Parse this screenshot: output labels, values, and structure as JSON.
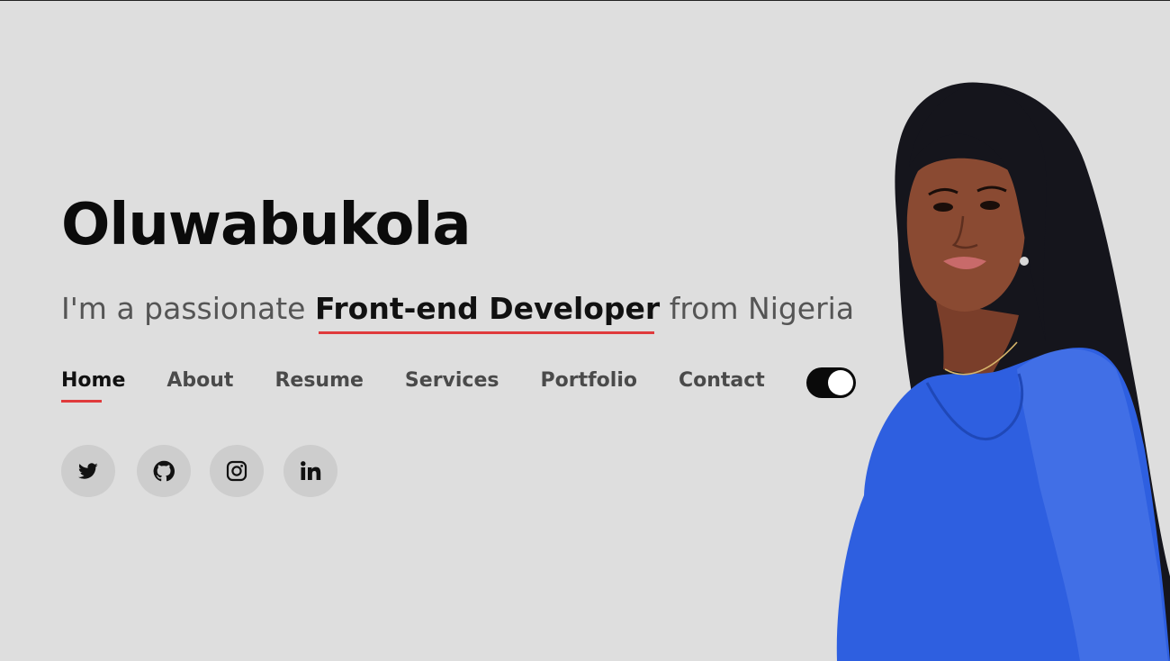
{
  "hero": {
    "name": "Oluwabukola",
    "tagline_prefix": "I'm a passionate",
    "tagline_role": "Front-end Developer",
    "tagline_suffix": "from Nigeria"
  },
  "nav": {
    "items": [
      {
        "label": "Home",
        "active": true
      },
      {
        "label": "About",
        "active": false
      },
      {
        "label": "Resume",
        "active": false
      },
      {
        "label": "Services",
        "active": false
      },
      {
        "label": "Portfolio",
        "active": false
      },
      {
        "label": "Contact",
        "active": false
      }
    ]
  },
  "theme_toggle": {
    "state": "on"
  },
  "social": [
    {
      "icon": "twitter-icon"
    },
    {
      "icon": "github-icon"
    },
    {
      "icon": "instagram-icon"
    },
    {
      "icon": "linkedin-icon"
    }
  ],
  "colors": {
    "background": "#dedede",
    "accent": "#e03a3c",
    "text": "#111111",
    "dress": "#2e5fe0"
  }
}
